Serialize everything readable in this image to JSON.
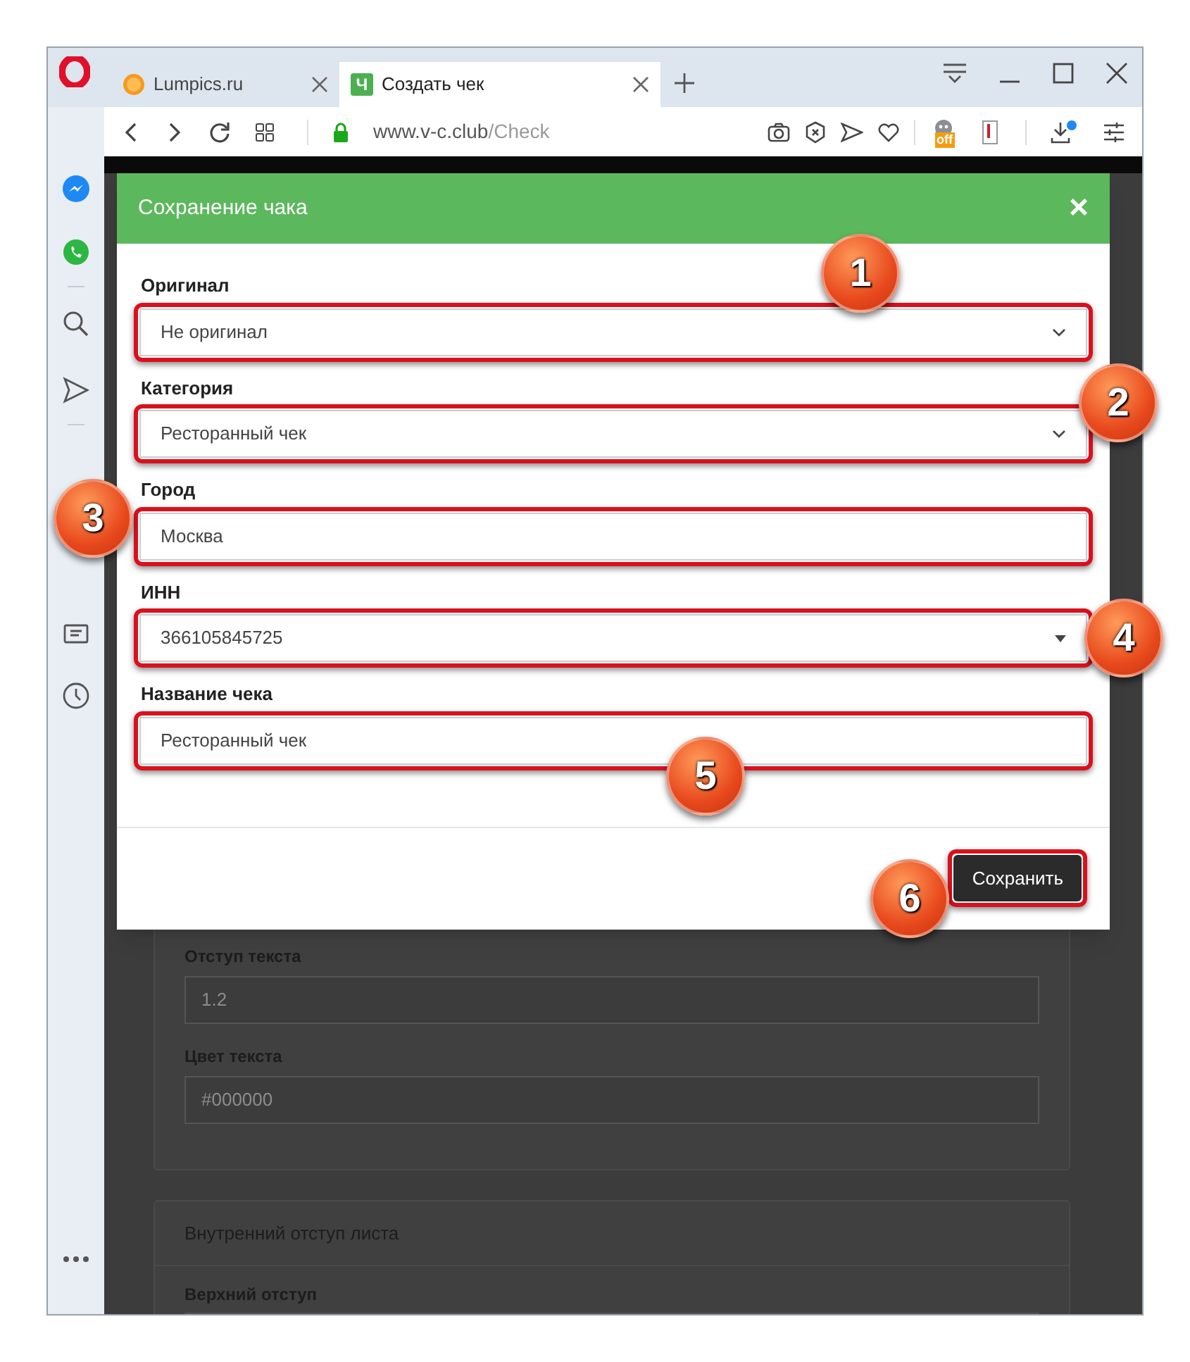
{
  "browser": {
    "tabs": [
      {
        "title": "Lumpics.ru",
        "selected": false
      },
      {
        "title": "Создать чек",
        "favicon_text": "Ч",
        "selected": true
      }
    ],
    "url_host": "www.v-c.club",
    "url_path": "/Check",
    "extension_badge": "off"
  },
  "background_page": {
    "fields": [
      {
        "label": "Отступ текста",
        "value": "1.2"
      },
      {
        "label": "Цвет текста",
        "value": "#000000"
      }
    ],
    "section_title": "Внутренний отступ листа",
    "section_field_label": "Верхний отступ"
  },
  "modal": {
    "title": "Сохранение чака",
    "close": "×",
    "fields": [
      {
        "kind": "select",
        "label": "Оригинал",
        "value": "Не оригинал",
        "highlighted": true
      },
      {
        "kind": "select",
        "label": "Категория",
        "value": "Ресторанный чек",
        "highlighted": true
      },
      {
        "kind": "input",
        "label": "Город",
        "value": "Москва",
        "highlighted": true
      },
      {
        "kind": "combobox",
        "label": "ИНН",
        "value": "366105845725",
        "highlighted": true
      },
      {
        "kind": "input",
        "label": "Название чека",
        "value": "Ресторанный чек",
        "highlighted": true
      }
    ],
    "save_button": {
      "label": "Сохранить",
      "highlighted": true
    }
  },
  "callouts": [
    "1",
    "2",
    "3",
    "4",
    "5",
    "6"
  ]
}
